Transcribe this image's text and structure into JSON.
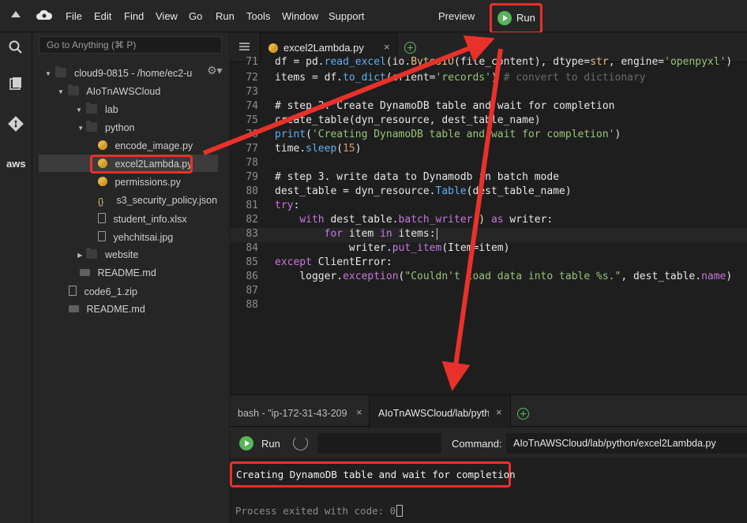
{
  "menubar": {
    "items": [
      "File",
      "Edit",
      "Find",
      "View",
      "Go",
      "Run",
      "Tools",
      "Window",
      "Support"
    ],
    "preview": "Preview",
    "run": "Run"
  },
  "sidebar_icons": [
    "search-icon",
    "files-icon",
    "git-icon",
    "aws-icon"
  ],
  "aws_label": "aws",
  "tree": {
    "goto_placeholder": "Go to Anything (⌘ P)",
    "nodes": [
      {
        "label": "cloud9-0815 - /home/ec2-u",
        "kind": "folder",
        "open": true
      },
      {
        "label": "AIoTnAWSCloud",
        "kind": "folder",
        "open": true
      },
      {
        "label": "lab",
        "kind": "folder",
        "open": true
      },
      {
        "label": "python",
        "kind": "folder",
        "open": true
      },
      {
        "label": "encode_image.py",
        "kind": "py"
      },
      {
        "label": "excel2Lambda.py",
        "kind": "py",
        "selected": true
      },
      {
        "label": "permissions.py",
        "kind": "py"
      },
      {
        "label": "s3_security_policy.json",
        "kind": "json"
      },
      {
        "label": "student_info.xlsx",
        "kind": "file"
      },
      {
        "label": "yehchitsai.jpg",
        "kind": "image"
      },
      {
        "label": "website",
        "kind": "folder",
        "open": false
      },
      {
        "label": "README.md",
        "kind": "md"
      },
      {
        "label": "code6_1.zip",
        "kind": "file"
      },
      {
        "label": "README.md",
        "kind": "md"
      }
    ]
  },
  "editor": {
    "tab_label": "excel2Lambda.py",
    "close_glyph": "×",
    "line_numbers": [
      "71",
      "72",
      "73",
      "74",
      "75",
      "76",
      "77",
      "78",
      "79",
      "80",
      "81",
      "82",
      "83",
      "84",
      "85",
      "86",
      "87",
      "88"
    ],
    "lines": [
      "df = pd.read_excel(io.BytesIO(file_content), dtype=str, engine='openpyxl')",
      "items = df.to_dict(orient='records') # convert to dictionary",
      "",
      "# step 2. Create DynamoDB table and wait for completion",
      "create_table(dyn_resource, dest_table_name)",
      "print('Creating DynamoDB table and wait for completion')",
      "time.sleep(15)",
      "",
      "# step 3. write data to Dynamodb in batch mode",
      "dest_table = dyn_resource.Table(dest_table_name)",
      "try:",
      "    with dest_table.batch_writer() as writer:",
      "        for item in items:",
      "            writer.put_item(Item=item)",
      "except ClientError:",
      "    logger.exception(\"Couldn't load data into table %s.\", dest_table.name)",
      "",
      ""
    ]
  },
  "terminal": {
    "tab_bash": "bash - \"ip-172-31-43-209",
    "tab_run": "AIoTnAWSCloud/lab/python",
    "run_label": "Run",
    "command_label": "Command:",
    "command_value": "AIoTnAWSCloud/lab/python/excel2Lambda.py",
    "output_line": "Creating DynamoDB table and wait for completion",
    "exit_line": "Process exited with code: 0"
  },
  "colors": {
    "annotation_red": "#e8312a",
    "run_green": "#57b65a"
  }
}
